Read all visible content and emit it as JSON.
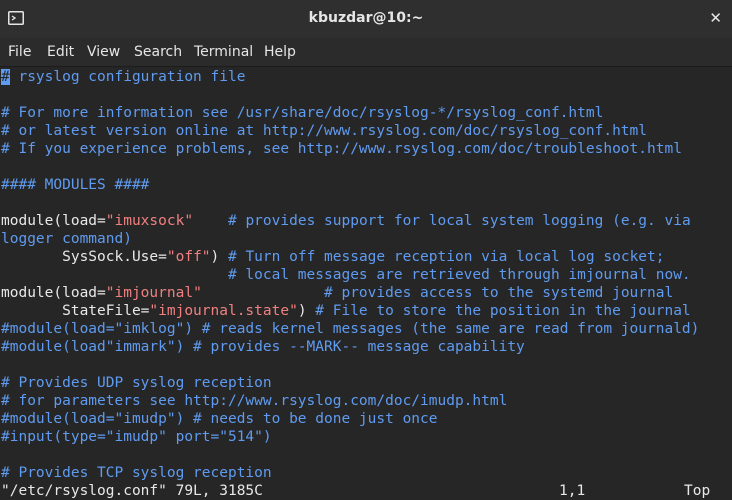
{
  "window": {
    "title": "kbuzdar@10:~",
    "terminal_icon": "terminal-icon",
    "close_symbol": "✕"
  },
  "menu": [
    "File",
    "Edit",
    "View",
    "Search",
    "Terminal",
    "Help"
  ],
  "editor": {
    "l1_cursor": "#",
    "l1_rest": " rsyslog configuration file",
    "l3": "# For more information see /usr/share/doc/rsyslog-*/rsyslog_conf.html",
    "l4": "# or latest version online at http://www.rsyslog.com/doc/rsyslog_conf.html",
    "l5": "# If you experience problems, see http://www.rsyslog.com/doc/troubleshoot.html",
    "l7": "#### MODULES ####",
    "l9_a": "module(load=",
    "l9_b": "\"imuxsock\"",
    "l9_c": "    # provides support for local system logging (e.g. via",
    "l10": "logger command)",
    "l11_a": "       SysSock.Use=",
    "l11_b": "\"off\"",
    "l11_c": ")",
    "l11_d": " # Turn off message reception via local log socket;",
    "l12": "                          # local messages are retrieved through imjournal now.",
    "l13_a": "module(load=",
    "l13_b": "\"imjournal\"",
    "l13_c": "              # provides access to the systemd journal",
    "l14_a": "       StateFile=",
    "l14_b": "\"imjournal.state\"",
    "l14_c": ")",
    "l14_d": " # File to store the position in the journal",
    "l15": "#module(load=\"imklog\") # reads kernel messages (the same are read from journald)",
    "l16": "#module(load\"immark\") # provides --MARK-- message capability",
    "l18": "# Provides UDP syslog reception",
    "l19": "# for parameters see http://www.rsyslog.com/doc/imudp.html",
    "l20": "#module(load=\"imudp\") # needs to be done just once",
    "l21": "#input(type=\"imudp\" port=\"514\")",
    "l23": "# Provides TCP syslog reception"
  },
  "status": {
    "file": "\"/etc/rsyslog.conf\" 79L, 3185C",
    "position": "1,1",
    "scroll": "Top"
  },
  "colors": {
    "comment": "#5f9bf0",
    "string": "#f08080",
    "text": "#e8e8e8",
    "background": "#262626"
  }
}
